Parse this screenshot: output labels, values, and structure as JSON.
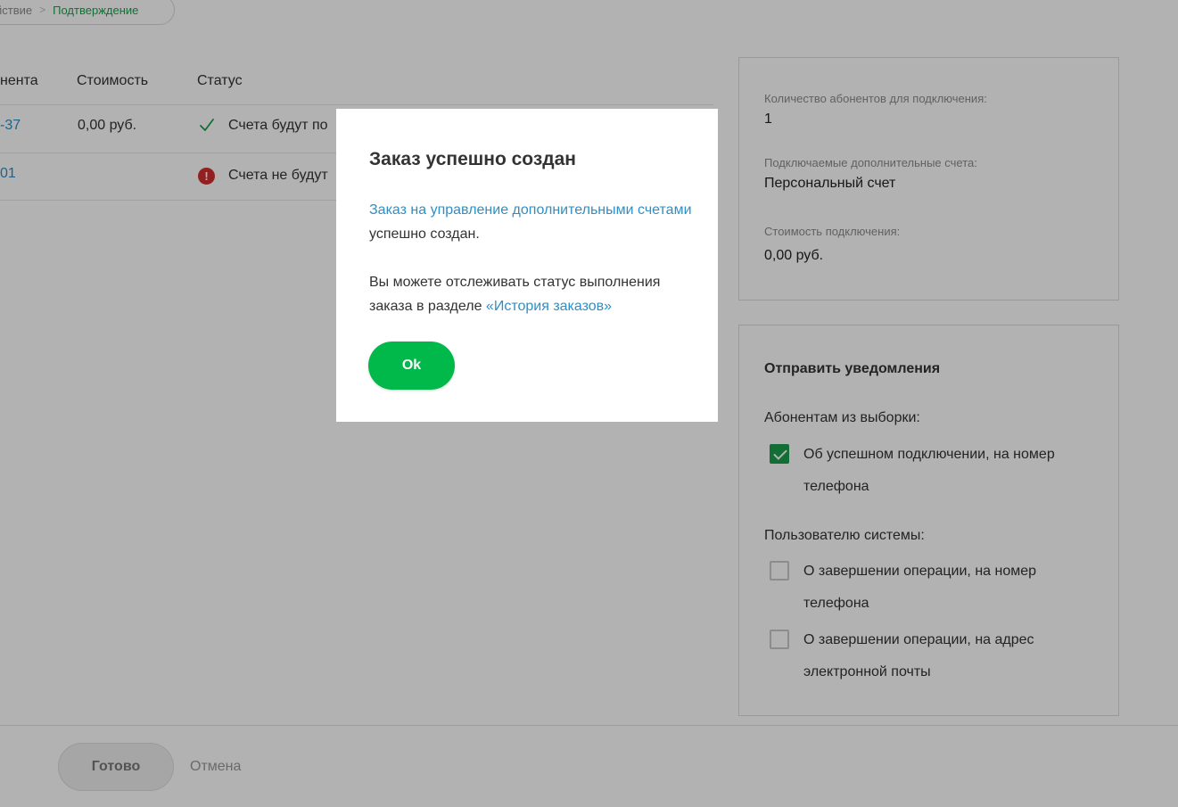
{
  "breadcrumb": {
    "previous": "йствие",
    "separator": ">",
    "current": "Подтверждение"
  },
  "table": {
    "headers": [
      "нента",
      "Стоимость",
      "Статус"
    ],
    "rows": [
      {
        "account": "-37",
        "cost": "0,00 руб.",
        "status": "Счета будут по"
      },
      {
        "account": "01",
        "cost": "",
        "status": "Счета не будут"
      }
    ]
  },
  "summary": {
    "subscribers_label": "Количество абонентов для подключения:",
    "subscribers_value": "1",
    "accounts_label": "Подключаемые дополнительные счета:",
    "accounts_value": "Персональный счет",
    "cost_label": "Стоимость подключения:",
    "cost_value": "0,00 руб."
  },
  "notifications": {
    "title": "Отправить уведомления",
    "subscribers_heading": "Абонентам из выборки:",
    "opt_success_phone": "Об успешном подключении, на номер телефона",
    "system_user_heading": "Пользователю системы:",
    "opt_complete_phone": "О завершении операции, на номер телефона",
    "opt_complete_email": "О завершении операции, на адрес электронной почты",
    "checked": [
      true,
      false,
      false
    ]
  },
  "footer": {
    "done_label": "Готово",
    "cancel_label": "Отмена"
  },
  "modal": {
    "title": "Заказ успешно создан",
    "p1_link": "Заказ на управление дополнительными счетами",
    "p1_rest": " успешно создан.",
    "p2_text": "Вы можете отслеживать статус выполнения заказа в разделе ",
    "p2_link": "«История заказов»",
    "ok_label": "Ok"
  },
  "icons": {
    "status_ok": "check-icon",
    "status_error": "error-icon"
  },
  "colors": {
    "accent_green": "#00b94a",
    "link_blue": "#2f8fc5",
    "error_red": "#d32f2f"
  }
}
